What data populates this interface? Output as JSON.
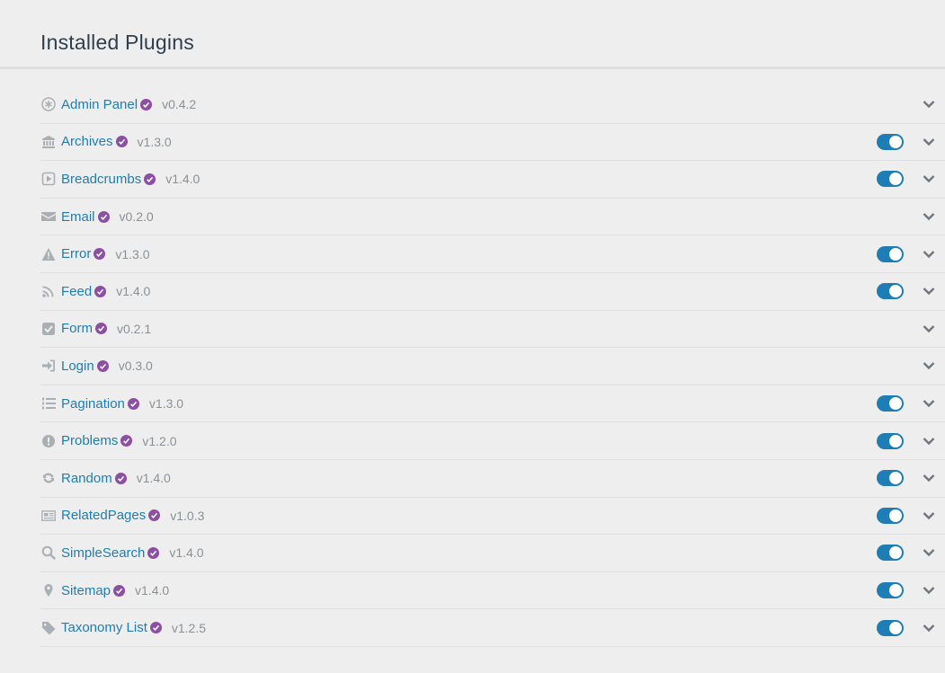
{
  "page": {
    "title": "Installed Plugins"
  },
  "accent_color": "#1f7db5",
  "verified_color": "#8d4fa3",
  "plugins": [
    {
      "name": "Admin Panel",
      "version": "v0.4.2",
      "icon": "asterisk-icon",
      "toggle": null
    },
    {
      "name": "Archives",
      "version": "v1.3.0",
      "icon": "bank-icon",
      "toggle": true
    },
    {
      "name": "Breadcrumbs",
      "version": "v1.4.0",
      "icon": "play-square-icon",
      "toggle": true
    },
    {
      "name": "Email",
      "version": "v0.2.0",
      "icon": "envelope-icon",
      "toggle": null
    },
    {
      "name": "Error",
      "version": "v1.3.0",
      "icon": "warning-icon",
      "toggle": true
    },
    {
      "name": "Feed",
      "version": "v1.4.0",
      "icon": "rss-icon",
      "toggle": true
    },
    {
      "name": "Form",
      "version": "v0.2.1",
      "icon": "check-square-icon",
      "toggle": null
    },
    {
      "name": "Login",
      "version": "v0.3.0",
      "icon": "sign-in-icon",
      "toggle": null
    },
    {
      "name": "Pagination",
      "version": "v1.3.0",
      "icon": "list-ol-icon",
      "toggle": true
    },
    {
      "name": "Problems",
      "version": "v1.2.0",
      "icon": "exclamation-circle-icon",
      "toggle": true
    },
    {
      "name": "Random",
      "version": "v1.4.0",
      "icon": "refresh-icon",
      "toggle": true
    },
    {
      "name": "RelatedPages",
      "version": "v1.0.3",
      "icon": "newspaper-icon",
      "toggle": true
    },
    {
      "name": "SimpleSearch",
      "version": "v1.4.0",
      "icon": "search-icon",
      "toggle": true
    },
    {
      "name": "Sitemap",
      "version": "v1.4.0",
      "icon": "map-marker-icon",
      "toggle": true
    },
    {
      "name": "Taxonomy List",
      "version": "v1.2.5",
      "icon": "tag-icon",
      "toggle": true
    }
  ]
}
